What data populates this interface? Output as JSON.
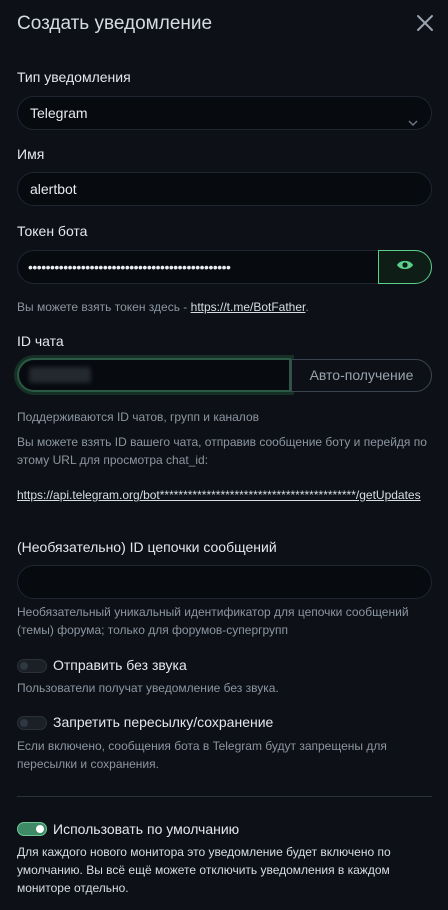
{
  "header": {
    "title": "Создать уведомление"
  },
  "notification_type": {
    "label": "Тип уведомления",
    "value": "Telegram"
  },
  "name": {
    "label": "Имя",
    "value": "alertbot"
  },
  "bot_token": {
    "label": "Токен бота",
    "value": "••••••••••••••••••••••••••••••••••••••••••••••",
    "hint_prefix": "Вы можете взять токен здесь - ",
    "hint_link": "https://t.me/BotFather",
    "hint_suffix": "."
  },
  "chat_id": {
    "label": "ID чата",
    "value": "",
    "auto_button": "Авто-получение",
    "hint_supported": "Поддерживаются ID чатов, групп и каналов",
    "hint_how": "Вы можете взять ID вашего чата, отправив сообщение боту и перейдя по этому URL для просмотра chat_id:",
    "hint_url": "https://api.telegram.org/bot******************************************/getUpdates"
  },
  "thread_id": {
    "label": "(Необязательно) ID цепочки сообщений",
    "value": "",
    "hint": "Необязательный уникальный идентификатор для цепочки сообщений (темы) форума; только для форумов-супергрупп"
  },
  "send_silently": {
    "label": "Отправить без звука",
    "enabled": false,
    "hint": "Пользователи получат уведомление без звука."
  },
  "protect_forwarding": {
    "label": "Запретить пересылку/сохранение",
    "enabled": false,
    "hint": "Если включено, сообщения бота в Telegram будут запрещены для пересылки и сохранения."
  },
  "default_enabled": {
    "label": "Использовать по умолчанию",
    "enabled": true,
    "hint": "Для каждого нового монитора это уведомление будет включено по умолчанию. Вы всё ещё можете отключить уведомления в каждом мониторе отдельно."
  },
  "colors": {
    "accent": "#5cd08a",
    "background": "#0d1117"
  }
}
